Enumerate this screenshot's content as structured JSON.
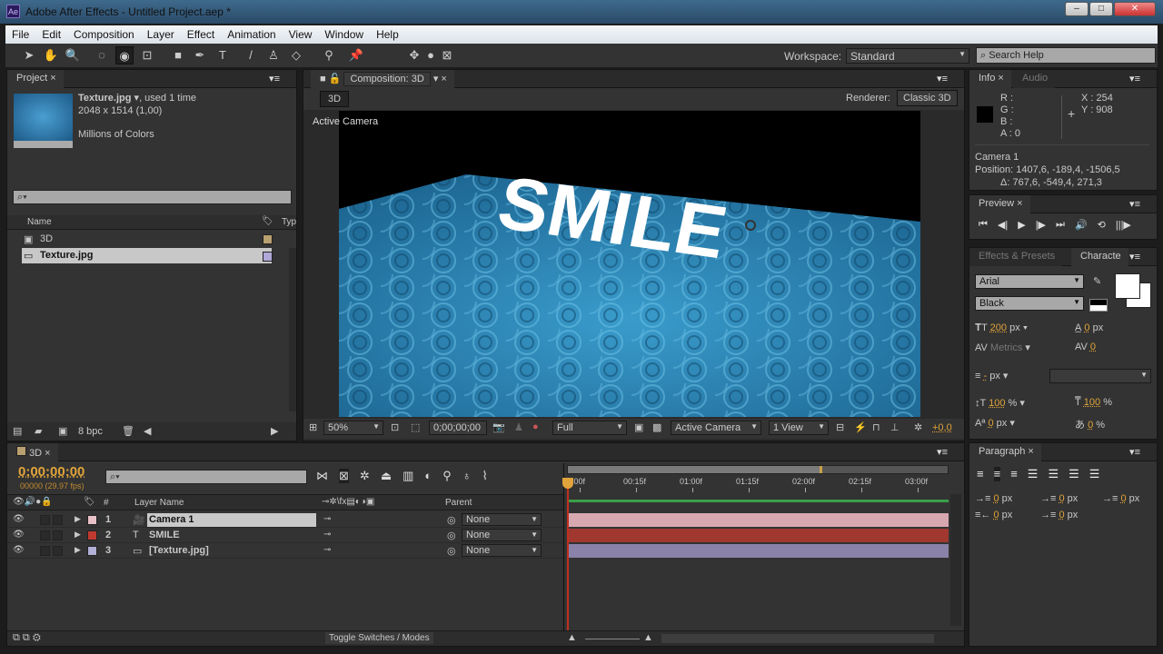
{
  "window": {
    "title": "Adobe After Effects - Untitled Project.aep *",
    "app_icon": "Ae"
  },
  "menu": [
    "File",
    "Edit",
    "Composition",
    "Layer",
    "Effect",
    "Animation",
    "View",
    "Window",
    "Help"
  ],
  "toolbar": {
    "workspace_label": "Workspace:",
    "workspace_value": "Standard",
    "search_placeholder": "Search Help"
  },
  "project": {
    "tab": "Project",
    "file_name": "Texture.jpg",
    "used": ", used 1 time",
    "dimensions": "2048 x 1514 (1,00)",
    "colors": "Millions of Colors",
    "col_name": "Name",
    "col_type": "Typ",
    "items": [
      {
        "name": "3D",
        "color": "#b8a070"
      },
      {
        "name": "Texture.jpg",
        "color": "#b0a8d8"
      }
    ],
    "bpc": "8 bpc"
  },
  "composition": {
    "tab": "Composition: 3D",
    "comp_button": "3D",
    "renderer_label": "Renderer:",
    "renderer_value": "Classic 3D",
    "view_label": "Active Camera",
    "overlay_text": "SMILE",
    "zoom": "50%",
    "timecode": "0;00;00;00",
    "resolution": "Full",
    "camera": "Active Camera",
    "views": "1 View",
    "exposure": "+0,0"
  },
  "info": {
    "tab": "Info",
    "tab2": "Audio",
    "r": "R :",
    "g": "G :",
    "b": "B :",
    "a": "A : 0",
    "x": "X : 254",
    "y": "Y : 908",
    "layer": "Camera 1",
    "position": "Position: 1407,6, -189,4, -1506,5",
    "delta": "Δ: 767,6, -549,4, 271,3"
  },
  "preview": {
    "tab": "Preview"
  },
  "character": {
    "tab1": "Effects & Presets",
    "tab2": "Characte",
    "font": "Arial",
    "style": "Black",
    "size": "200",
    "size_unit": "px",
    "leading": "0",
    "leading_unit": "px",
    "kerning": "Metrics",
    "tracking": "0",
    "stroke": "-",
    "stroke_unit": "px",
    "vscale": "100",
    "vscale_unit": "%",
    "hscale": "100",
    "hscale_unit": "%",
    "baseline": "0",
    "baseline_unit": "px",
    "tsume": "0",
    "tsume_unit": "%"
  },
  "paragraph": {
    "tab": "Paragraph",
    "indent_left": "0",
    "indent_first": "0",
    "indent_right": "0",
    "space_before": "0",
    "space_after": "0",
    "unit": "px"
  },
  "timeline": {
    "tab": "3D",
    "timecode": "0;00;00;00",
    "fps": "00000 (29.97 fps)",
    "col_layer_name": "Layer Name",
    "col_num": "#",
    "col_parent": "Parent",
    "ruler": [
      "0:00f",
      "00:15f",
      "01:00f",
      "01:15f",
      "02:00f",
      "02:15f",
      "03:00f"
    ],
    "layers": [
      {
        "num": "1",
        "name": "Camera 1",
        "label_color": "#e8c0c8",
        "bar_color": "#d8a8b0",
        "parent": "None",
        "icon": "camera-icon"
      },
      {
        "num": "2",
        "name": "SMILE",
        "label_color": "#c03a30",
        "bar_color": "#a03830",
        "parent": "None",
        "icon": "text-icon"
      },
      {
        "num": "3",
        "name": "[Texture.jpg]",
        "label_color": "#b0b0d8",
        "bar_color": "#8a82a8",
        "parent": "None",
        "icon": "image-icon"
      }
    ],
    "toggle_label": "Toggle Switches / Modes"
  }
}
